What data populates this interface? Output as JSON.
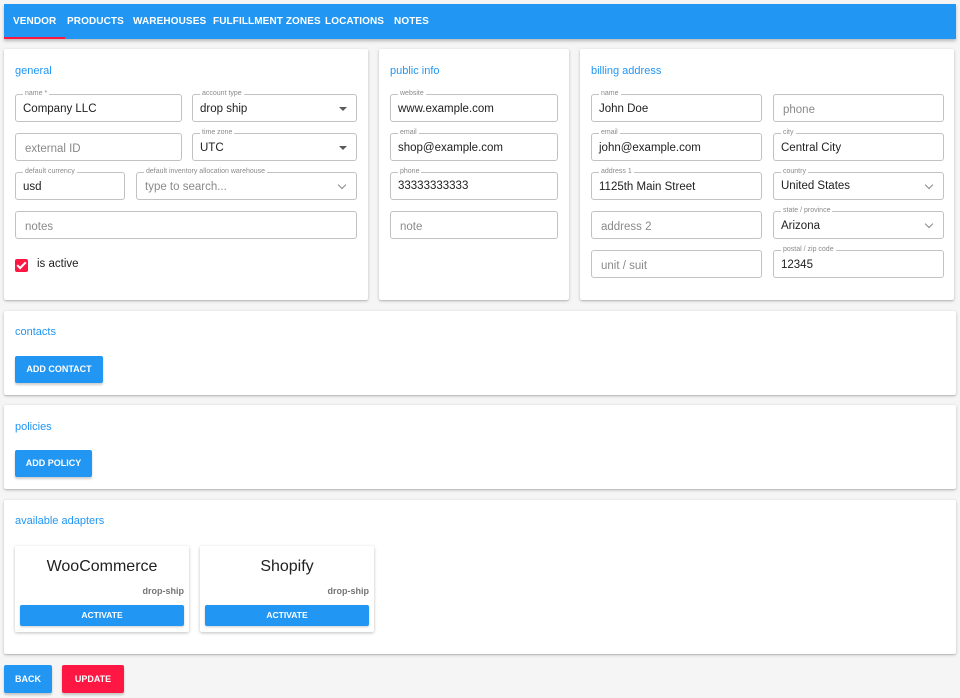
{
  "nav": {
    "tabs": [
      "VENDOR",
      "PRODUCTS",
      "WAREHOUSES",
      "FULFILLMENT ZONES",
      "LOCATIONS",
      "NOTES"
    ],
    "active_tab": "VENDOR"
  },
  "general": {
    "title": "general",
    "name": {
      "label": "name *",
      "value": "Company LLC"
    },
    "account_type": {
      "label": "account type",
      "value": "drop ship"
    },
    "external_id": {
      "placeholder": "external ID"
    },
    "time_zone": {
      "label": "time zone",
      "value": "UTC"
    },
    "default_currency": {
      "label": "default currency",
      "value": "usd"
    },
    "default_warehouse": {
      "label": "default inventory allocation warehouse",
      "placeholder": "type to search..."
    },
    "notes": {
      "placeholder": "notes"
    },
    "is_active": {
      "label": "is active",
      "checked": true
    }
  },
  "public_info": {
    "title": "public info",
    "website": {
      "label": "website",
      "value": "www.example.com"
    },
    "email": {
      "label": "email",
      "value": "shop@example.com"
    },
    "phone": {
      "label": "phone",
      "value": "33333333333"
    },
    "note": {
      "placeholder": "note"
    }
  },
  "billing": {
    "title": "billing address",
    "name": {
      "label": "name",
      "value": "John Doe"
    },
    "phone": {
      "placeholder": "phone"
    },
    "email": {
      "label": "email",
      "value": "john@example.com"
    },
    "city": {
      "label": "city",
      "value": "Central City"
    },
    "address1": {
      "label": "address 1",
      "value": "1125th Main Street"
    },
    "country": {
      "label": "country",
      "value": "United States"
    },
    "address2": {
      "placeholder": "address 2"
    },
    "state": {
      "label": "state / province",
      "value": "Arizona"
    },
    "unit": {
      "placeholder": "unit / suit"
    },
    "postal": {
      "label": "postal / zip code",
      "value": "12345"
    }
  },
  "contacts": {
    "title": "contacts",
    "button": "ADD CONTACT"
  },
  "policies": {
    "title": "policies",
    "button": "ADD POLICY"
  },
  "adapters": {
    "title": "available adapters",
    "items": [
      {
        "name": "WooCommerce",
        "type": "drop-ship",
        "button": "ACTIVATE"
      },
      {
        "name": "Shopify",
        "type": "drop-ship",
        "button": "ACTIVATE"
      }
    ]
  },
  "footer": {
    "back": "BACK",
    "update": "UPDATE"
  },
  "colors": {
    "primary": "#2196f3",
    "accent": "#ff1744"
  }
}
